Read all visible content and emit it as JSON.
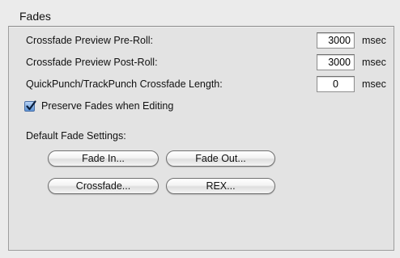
{
  "section": {
    "title": "Fades"
  },
  "rows": [
    {
      "label": "Crossfade Preview Pre-Roll:",
      "value": "3000",
      "unit": "msec"
    },
    {
      "label": "Crossfade Preview Post-Roll:",
      "value": "3000",
      "unit": "msec"
    },
    {
      "label": "QuickPunch/TrackPunch Crossfade Length:",
      "value": "0",
      "unit": "msec"
    }
  ],
  "preserve_fades": {
    "label": "Preserve Fades when Editing",
    "checked": true
  },
  "default_fade_settings": {
    "label": "Default Fade Settings:",
    "buttons": {
      "fade_in": "Fade In...",
      "fade_out": "Fade Out...",
      "crossfade": "Crossfade...",
      "rex": "REX..."
    }
  },
  "colors": {
    "checkbox_accent": "#5e94d6"
  }
}
